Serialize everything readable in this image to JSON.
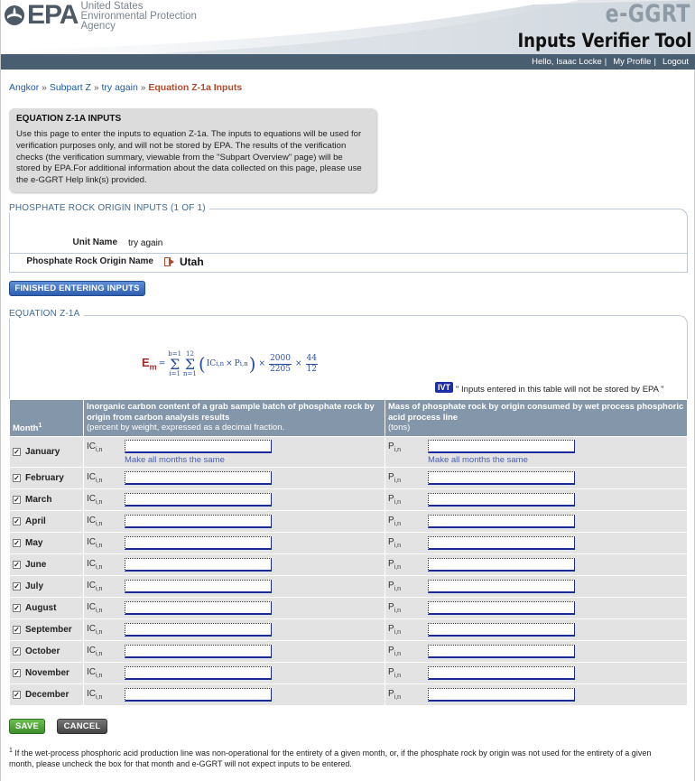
{
  "header": {
    "agency_lines": [
      "United States",
      "Environmental Protection",
      "Agency"
    ],
    "logo_text": "EPA",
    "product": "e-GGRT",
    "tool_title": "Inputs Verifier Tool"
  },
  "userbar": {
    "greeting": "Hello, Isaac Locke",
    "my_profile": "My Profile",
    "logout": "Logout"
  },
  "breadcrumb": {
    "items": [
      "Angkor",
      "Subpart Z",
      "try again"
    ],
    "current": "Equation Z-1a Inputs",
    "separator": "»"
  },
  "info": {
    "title": "EQUATION Z-1A INPUTS",
    "body": "Use this page to enter the inputs to equation Z-1a. The inputs to equations will be used for verification purposes only, and will not be stored by EPA. The results of the verification checks (the verification summary, viewable from the \"Subpart Overview\" page) will be stored by EPA.For additional information about the data collected on this page, please use the e-GGRT Help link(s) provided."
  },
  "origin": {
    "section_title": "PHOSPHATE ROCK ORIGIN INPUTS (1 OF 1)",
    "unit_name_label": "Unit Name",
    "unit_name_value": "try again",
    "origin_label": "Phosphate Rock Origin Name",
    "origin_value": "Utah"
  },
  "finished_button": "FINISHED ENTERING INPUTS",
  "equation": {
    "section_title": "EQUATION Z-1A",
    "lhs": "E",
    "lhs_sub": "m",
    "sum1_top": "b=1",
    "sum1_bottom": "i=1",
    "sum2_top": "12",
    "sum2_bottom": "n=1",
    "ic": "IC",
    "ic_sub": "i,n",
    "p": "P",
    "p_sub": "i,n",
    "frac1_num": "2000",
    "frac1_den": "2205",
    "frac2_num": "44",
    "frac2_den": "12",
    "times": "×",
    "equals": "="
  },
  "ivt_badge": "IVT",
  "ivt_note": "\" Inputs entered in this table will not be stored by EPA \"",
  "table": {
    "month_header": "Month",
    "month_sup": "1",
    "col1_header": "Inorganic carbon content of a grab sample batch of phosphate rock by origin from carbon analysis results",
    "col1_sub": "(percent by weight, expressed as a decimal fraction.",
    "col2_header": "Mass of phosphate rock by origin consumed by wet process phosphoric acid process line",
    "col2_sub": "(tons)",
    "ic_symbol": "IC",
    "p_symbol": "P",
    "symbol_sub": "i,n",
    "make_same": "Make all months the same",
    "months": [
      "January",
      "February",
      "March",
      "April",
      "May",
      "June",
      "July",
      "August",
      "September",
      "October",
      "November",
      "December"
    ],
    "checkmark": "✓"
  },
  "buttons": {
    "save": "SAVE",
    "cancel": "CANCEL"
  },
  "footnote": {
    "sup": "1",
    "text": "If the wet-process phosphoric acid production line was non-operational for the entirety of a given month, or, if the phosphate rock by origin was not used for the entirety of a given month, please uncheck the box for that month and e-GGRT will not expect inputs to be entered."
  },
  "colors": {
    "userbar": "#4a5e72",
    "table_header": "#8396aa",
    "link": "#1f5aa6",
    "current_crumb": "#b34a2a"
  }
}
